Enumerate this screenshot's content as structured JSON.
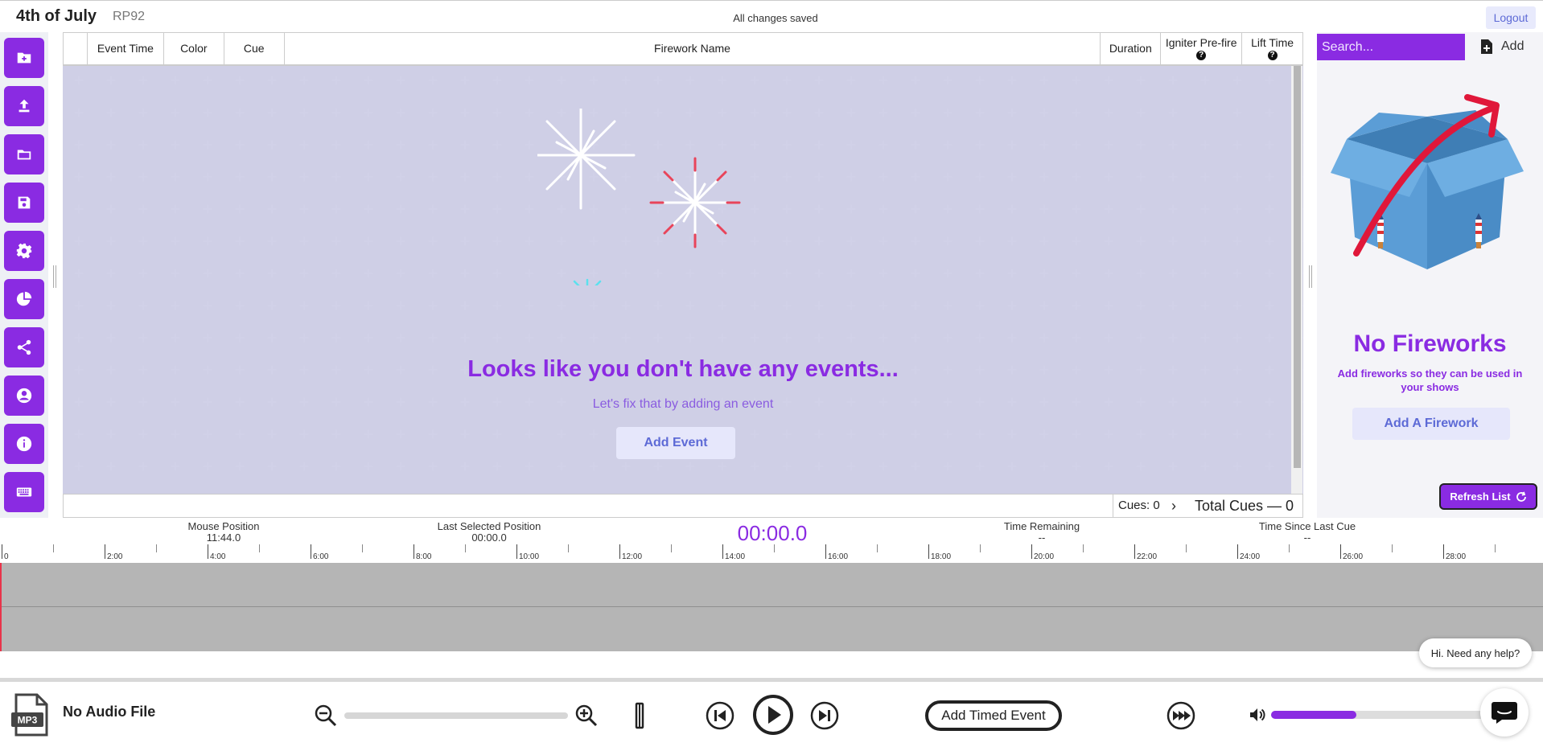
{
  "header": {
    "show_title": "4th of July",
    "show_code": "RP92",
    "save_status": "All changes saved",
    "logout_label": "Logout"
  },
  "sidebar": {
    "buttons": [
      {
        "icon": "new-folder-icon"
      },
      {
        "icon": "upload-icon"
      },
      {
        "icon": "folder-icon"
      },
      {
        "icon": "save-icon"
      },
      {
        "icon": "gear-icon"
      },
      {
        "icon": "pie-chart-icon"
      },
      {
        "icon": "share-icon"
      },
      {
        "icon": "account-icon"
      },
      {
        "icon": "info-icon"
      },
      {
        "icon": "keyboard-icon"
      }
    ]
  },
  "table": {
    "columns": [
      "Event Time",
      "Color",
      "Cue",
      "Firework Name",
      "Duration",
      "Igniter Pre-fire",
      "Lift Time"
    ],
    "empty_title": "Looks like you don't have any events...",
    "empty_subtitle": "Let's fix that by adding an event",
    "add_event_label": "Add Event",
    "cues_label": "Cues: 0",
    "total_cues_label": "Total Cues — 0"
  },
  "fireworks_panel": {
    "search_placeholder": "Search...",
    "add_label": "Add",
    "empty_title": "No Fireworks",
    "empty_subtitle": "Add fireworks so they can be used in your shows",
    "add_firework_label": "Add A Firework",
    "refresh_label": "Refresh List"
  },
  "stats": {
    "mouse_position_label": "Mouse Position",
    "mouse_position_value": "11:44.0",
    "last_selected_label": "Last Selected Position",
    "last_selected_value": "00:00.0",
    "clock": "00:00.0",
    "time_remaining_label": "Time Remaining",
    "time_remaining_value": "--",
    "time_since_label": "Time Since Last Cue",
    "time_since_value": "--"
  },
  "ruler": {
    "labels": [
      "0",
      "2:00",
      "4:00",
      "6:00",
      "8:00",
      "10:00",
      "12:00",
      "14:00",
      "16:00",
      "18:00",
      "20:00",
      "22:00",
      "24:00",
      "26:00",
      "28:00"
    ]
  },
  "player": {
    "audio_badge": "MP3",
    "audio_label": "No Audio File",
    "add_timed_event_label": "Add Timed Event",
    "volume_level": 0.4,
    "help_text": "Hi. Need any help?"
  },
  "colors": {
    "accent": "#8a2be2",
    "button_soft": "#e6e7fb",
    "button_text": "#5d6ad6",
    "waveform": "#b5b5b5",
    "playhead": "#e8344a",
    "annotation_arrow": "#e0173a"
  }
}
